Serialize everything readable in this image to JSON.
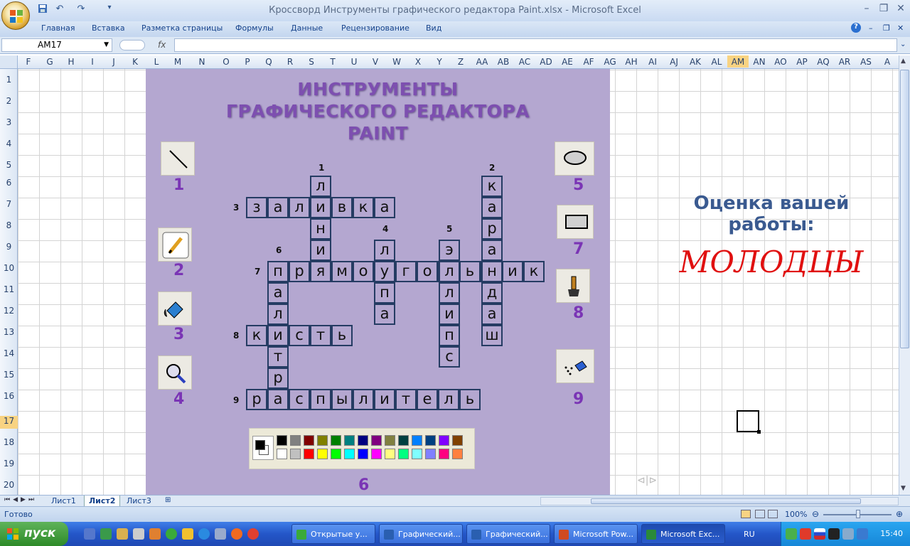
{
  "window": {
    "title": "Кроссворд Инструменты графического редактора Paint.xlsx - Microsoft Excel"
  },
  "ribbon_tabs": [
    "Главная",
    "Вставка",
    "Разметка страницы",
    "Формулы",
    "Данные",
    "Рецензирование",
    "Вид"
  ],
  "formula_bar": {
    "name_box": "AM17",
    "fx": "fx",
    "value": ""
  },
  "columns": [
    "F",
    "G",
    "H",
    "I",
    "J",
    "K",
    "L",
    "M",
    "N",
    "O",
    "P",
    "Q",
    "R",
    "S",
    "T",
    "U",
    "V",
    "W",
    "X",
    "Y",
    "Z",
    "AA",
    "AB",
    "AC",
    "AD",
    "AE",
    "AF",
    "AG",
    "AH",
    "AI",
    "AJ",
    "AK",
    "AL",
    "AM",
    "AN",
    "AO",
    "AP",
    "AQ",
    "AR",
    "AS",
    "A"
  ],
  "selected_column": "AM",
  "rows": [
    "1",
    "2",
    "3",
    "4",
    "5",
    "6",
    "7",
    "8",
    "9",
    "10",
    "11",
    "12",
    "13",
    "14",
    "15",
    "16",
    "17",
    "18",
    "19",
    "20"
  ],
  "selected_row": "17",
  "puzzle": {
    "title_lines": [
      "ИНСТРУМЕНТЫ",
      "ГРАФИЧЕСКОГО РЕДАКТОРА",
      "PAINT"
    ],
    "left_tools": [
      "1",
      "2",
      "3",
      "4"
    ],
    "right_tools": [
      "5",
      "7",
      "8",
      "9"
    ],
    "palette_number": "6",
    "clue_numbers": [
      "1",
      "2",
      "3",
      "4",
      "5",
      "6",
      "7",
      "8",
      "9"
    ],
    "words": {
      "w1": [
        "л",
        "и",
        "н",
        "и"
      ],
      "w2": [
        "к",
        "а",
        "р",
        "а",
        "н",
        "д",
        "а",
        "ш"
      ],
      "w3": [
        "з",
        "а",
        "л",
        "и",
        "в",
        "к",
        "а"
      ],
      "w4": [
        "л",
        "у",
        "п",
        "а"
      ],
      "w5": [
        "э",
        "л",
        "л",
        "и",
        "п",
        "с"
      ],
      "w6": [
        "п",
        "а",
        "л",
        "и",
        "т",
        "р"
      ],
      "w7": [
        "п",
        "р",
        "я",
        "м",
        "о",
        "у",
        "г",
        "о",
        "л",
        "ь",
        "н",
        "и",
        "к"
      ],
      "w8": [
        "к",
        "и",
        "с",
        "т",
        "ь"
      ],
      "w9": [
        "р",
        "а",
        "с",
        "п",
        "ы",
        "л",
        "и",
        "т",
        "е",
        "л",
        "ь"
      ]
    }
  },
  "score": {
    "label": "Оценка вашей работы:",
    "value": "МОЛОДЦЫ"
  },
  "sheets": [
    "Лист1",
    "Лист2",
    "Лист3"
  ],
  "active_sheet": "Лист2",
  "status": {
    "text": "Готово",
    "zoom": "100%"
  },
  "taskbar": {
    "start": "пуск",
    "items": [
      "Открытые у...",
      "Графический...",
      "Графический...",
      "Microsoft Pow...",
      "Microsoft Exc..."
    ],
    "active_item": "Microsoft Exc...",
    "lang": "RU",
    "clock": "15:40"
  },
  "colors": {
    "panel": "#b4a7d0",
    "title": "#7d4fb0",
    "score_label": "#3a5a90",
    "score_value": "#e01010",
    "palette_row1": [
      "#000000",
      "#808080",
      "#800000",
      "#808000",
      "#008000",
      "#008080",
      "#000080",
      "#800080",
      "#808040",
      "#004040",
      "#0080ff",
      "#004080",
      "#8000ff",
      "#804000"
    ],
    "palette_row2": [
      "#ffffff",
      "#c0c0c0",
      "#ff0000",
      "#ffff00",
      "#00ff00",
      "#00ffff",
      "#0000ff",
      "#ff00ff",
      "#ffff80",
      "#00ff80",
      "#80ffff",
      "#8080ff",
      "#ff0080",
      "#ff8040"
    ]
  }
}
